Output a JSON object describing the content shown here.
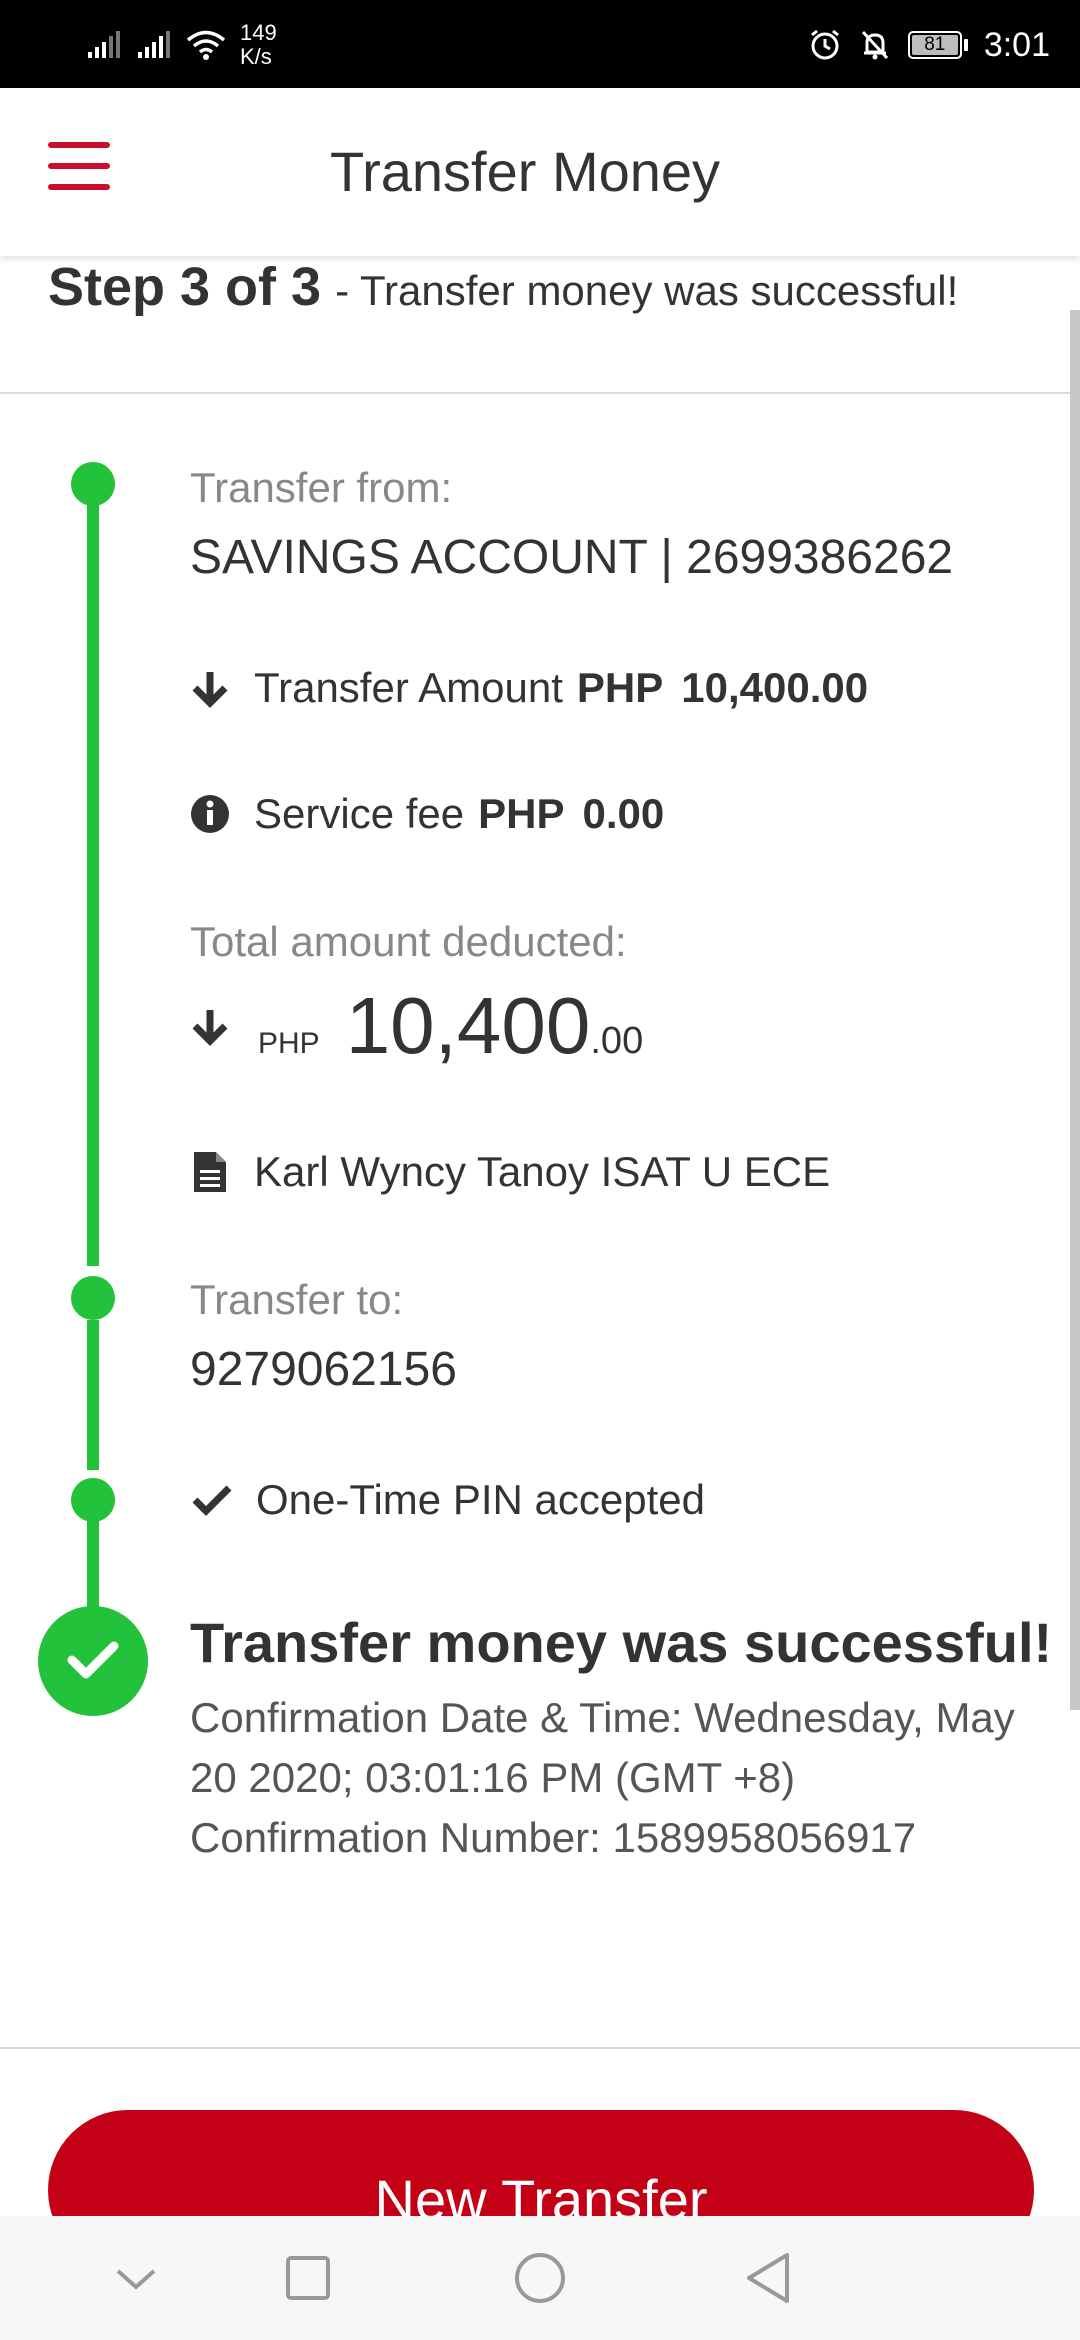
{
  "status_bar": {
    "net_speed_value": "149",
    "net_speed_unit": "K/s",
    "battery": "81",
    "time": "3:01",
    "icons": [
      "signal-icon",
      "signal-icon",
      "wifi-icon",
      "alarm-icon",
      "notifications-off-icon",
      "battery-icon"
    ]
  },
  "header": {
    "title": "Transfer Money",
    "menu_icon": "hamburger-menu-icon"
  },
  "step": {
    "label": "Step 3 of 3",
    "message": "- Transfer money was successful!"
  },
  "transfer_from": {
    "label": "Transfer from:",
    "account": "SAVINGS ACCOUNT | 2699386262"
  },
  "transfer_amount": {
    "label": "Transfer Amount",
    "currency": "PHP",
    "amount": "10,400.00",
    "icon": "arrow-down-icon"
  },
  "service_fee": {
    "label": "Service fee",
    "currency": "PHP",
    "amount": "0.00",
    "icon": "info-icon"
  },
  "total": {
    "label": "Total amount deducted:",
    "currency": "PHP",
    "whole": "10,400",
    "cents": ".00",
    "icon": "arrow-down-icon"
  },
  "note": {
    "text": "Karl Wyncy Tanoy ISAT U ECE",
    "icon": "document-icon"
  },
  "transfer_to": {
    "label": "Transfer to:",
    "number": "9279062156"
  },
  "otp": {
    "text": "One-Time PIN accepted",
    "icon": "check-icon"
  },
  "success": {
    "title": "Transfer money was successful!",
    "confirmation_date_line": "Confirmation Date & Time: Wednesday, May 20 2020; 03:01:16 PM (GMT +8)",
    "confirmation_number_line": "Confirmation Number: 1589958056917"
  },
  "actions": {
    "new_transfer": "New Transfer"
  },
  "colors": {
    "brand_red": "#c30016",
    "timeline_green": "#22c23a",
    "label_grey": "#888888",
    "text_dark": "#333333"
  }
}
